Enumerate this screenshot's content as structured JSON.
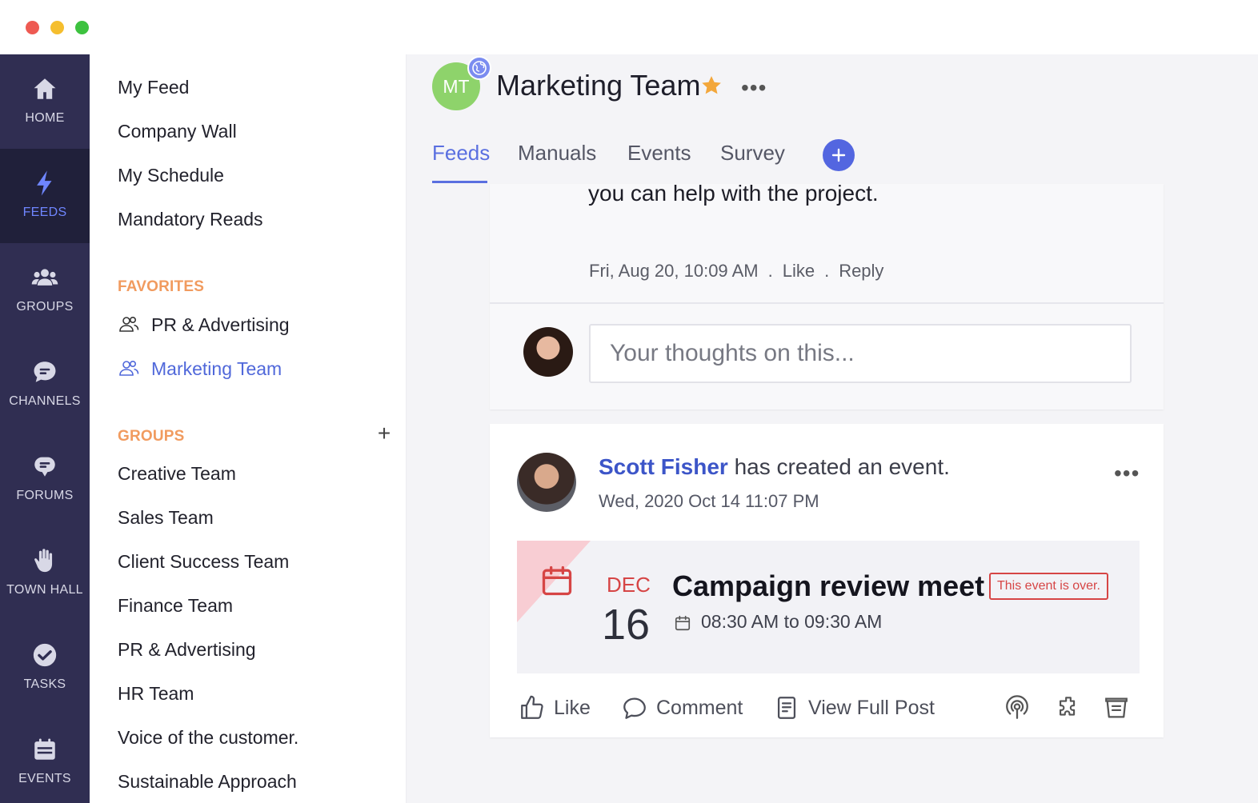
{
  "window": {
    "controls": [
      "close",
      "minimize",
      "zoom"
    ],
    "colors": {
      "close": "#ee5a52",
      "minimize": "#f5be2e",
      "zoom": "#3dc23f"
    }
  },
  "rail": {
    "items": [
      {
        "label": "HOME",
        "icon": "home-icon"
      },
      {
        "label": "FEEDS",
        "icon": "lightning-icon",
        "active": true
      },
      {
        "label": "GROUPS",
        "icon": "people-icon"
      },
      {
        "label": "CHANNELS",
        "icon": "chat-bubble-icon"
      },
      {
        "label": "FORUMS",
        "icon": "forum-icon"
      },
      {
        "label": "TOWN HALL",
        "icon": "raised-hand-icon"
      },
      {
        "label": "TASKS",
        "icon": "check-circle-icon"
      },
      {
        "label": "EVENTS",
        "icon": "calendar-icon"
      }
    ]
  },
  "nav": {
    "links": [
      "My Feed",
      "Company Wall",
      "My Schedule",
      "Mandatory Reads"
    ],
    "favorites_heading": "FAVORITES",
    "favorites": [
      {
        "label": "PR & Advertising",
        "icon": "group-icon"
      },
      {
        "label": "Marketing Team",
        "icon": "group-icon",
        "active": true
      }
    ],
    "groups_heading": "GROUPS",
    "groups_add": "+",
    "groups": [
      "Creative Team",
      "Sales Team",
      "Client Success Team",
      "Finance Team",
      "PR & Advertising",
      "HR Team",
      "Voice of the customer.",
      "Sustainable Approach"
    ]
  },
  "header": {
    "avatar_initials": "MT",
    "title": "Marketing Team",
    "more": "•••",
    "tabs": [
      {
        "label": "Feeds",
        "active": true
      },
      {
        "label": "Manuals"
      },
      {
        "label": "Events"
      },
      {
        "label": "Survey"
      }
    ]
  },
  "previous_post": {
    "text_tail": "you can help with the project.",
    "timestamp": "Fri, Aug 20, 10:09 AM",
    "separator": ".",
    "like": "Like",
    "reply": "Reply",
    "comment_placeholder": "Your thoughts on this...",
    "comment_value": ""
  },
  "event_post": {
    "author": "Scott Fisher",
    "action": " has created an event.",
    "timestamp": "Wed, 2020 Oct 14 11:07 PM",
    "more": "•••",
    "event": {
      "month": "DEC",
      "day": "16",
      "title": "Campaign review meet",
      "status": "This event is over.",
      "time": "08:30 AM to 09:30 AM"
    },
    "actions": {
      "like": "Like",
      "comment": "Comment",
      "view": "View Full Post"
    },
    "tools": [
      "broadcast-icon",
      "puzzle-icon",
      "archive-icon"
    ]
  },
  "colors": {
    "rail_bg": "#302e52",
    "rail_active_bg": "#20203a",
    "accent": "#5a6fe0",
    "section_heading": "#f19b5f",
    "event_red": "#d64545",
    "star": "#f3a73b"
  }
}
